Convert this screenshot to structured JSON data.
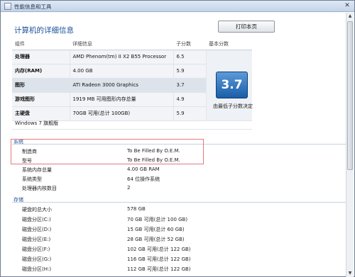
{
  "window": {
    "title": "性能信息和工具",
    "close_glyph": "✕",
    "app_icon": "window-icon"
  },
  "heading": "计算机的详细信息",
  "print_button": "打印本页",
  "score_table": {
    "headers": [
      "组件",
      "详细信息",
      "子分数",
      "基本分数"
    ],
    "rows": [
      {
        "component": "处理器",
        "details": "AMD Phenom(tm) II X2 B55 Processor",
        "subscore": "6.5"
      },
      {
        "component": "内存(RAM)",
        "details": "4.00 GB",
        "subscore": "5.9"
      },
      {
        "component": "图形",
        "details": "ATI Radeon 3000 Graphics",
        "subscore": "3.7"
      },
      {
        "component": "游戏图形",
        "details": "1919 MB 可用图形内存总量",
        "subscore": "4.9"
      },
      {
        "component": "主硬盘",
        "details": "70GB 可用(总计 100GB)",
        "subscore": "5.9"
      }
    ],
    "base_score": "3.7",
    "base_caption": "由最低子分数决定",
    "os": "Windows 7 旗舰版"
  },
  "system": {
    "title": "系统",
    "items": [
      {
        "label": "制造商",
        "value": "To Be Filled By O.E.M."
      },
      {
        "label": "型号",
        "value": "To Be Filled By O.E.M."
      },
      {
        "label": "系统内存总量",
        "value": "4.00 GB RAM"
      },
      {
        "label": "系统类型",
        "value": "64 位操作系统"
      },
      {
        "label": "处理器内核数目",
        "value": "2"
      }
    ]
  },
  "storage": {
    "title": "存储",
    "items": [
      {
        "label": "硬盘的总大小",
        "value": "578 GB"
      },
      {
        "label": "磁盘分区(C:)",
        "value": "70 GB 可用(总计 100 GB)"
      },
      {
        "label": "磁盘分区(D:)",
        "value": "15 GB 可用(总计 60 GB)"
      },
      {
        "label": "磁盘分区(E:)",
        "value": "28 GB 可用(总计 52 GB)"
      },
      {
        "label": "磁盘分区(F:)",
        "value": "102 GB 可用(总计 122 GB)"
      },
      {
        "label": "磁盘分区(G:)",
        "value": "116 GB 可用(总计 122 GB)"
      },
      {
        "label": "磁盘分区(H:)",
        "value": "112 GB 可用(总计 122 GB)"
      }
    ]
  },
  "colors": {
    "accent": "#1b4f9c",
    "highlight": "#e47a7a",
    "score_tile": "#1a5ea8"
  }
}
